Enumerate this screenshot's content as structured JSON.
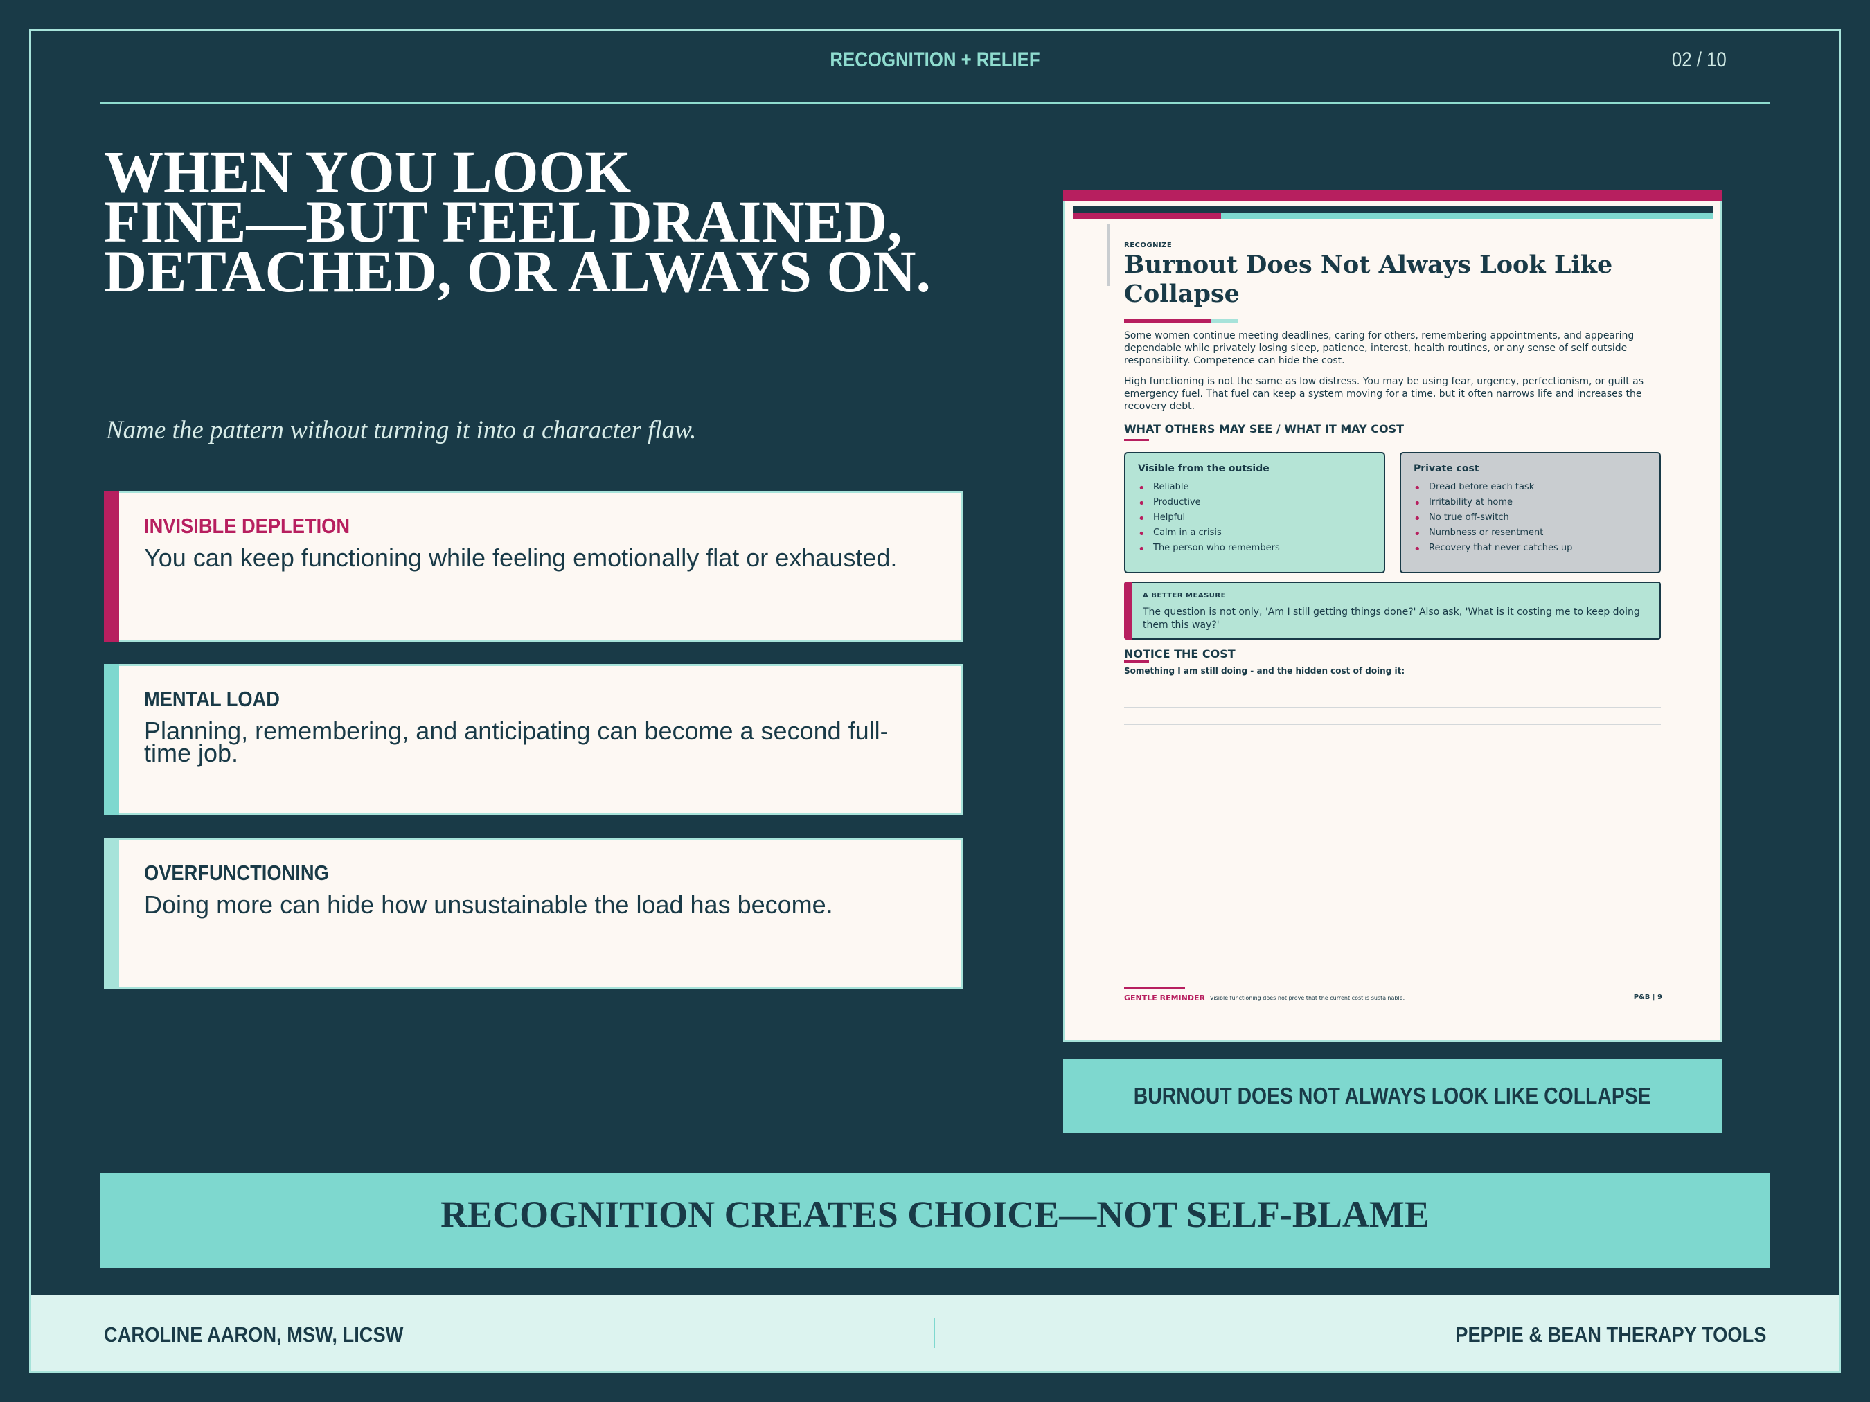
{
  "header": {
    "title": "RECOGNITION + RELIEF",
    "page": "02 / 10"
  },
  "headline": {
    "lines": [
      "WHEN YOU LOOK",
      "FINE—BUT FEEL DRAINED,",
      "DETACHED, OR ALWAYS ON."
    ]
  },
  "subline": "Name the pattern without turning it into a character flaw.",
  "cards": [
    {
      "title": "INVISIBLE DEPLETION",
      "body": "You can keep functioning while feeling emotionally flat or exhausted."
    },
    {
      "title": "MENTAL LOAD",
      "body": "Planning, remembering, and anticipating can become a second full-time job."
    },
    {
      "title": "OVERFUNCTIONING",
      "body": "Doing more can hide how unsustainable the load has become."
    }
  ],
  "document": {
    "kicker": "RECOGNIZE",
    "title": "Burnout Does Not Always Look Like Collapse",
    "p1": "Some women continue meeting deadlines, caring for others, remembering appointments, and appearing dependable while privately losing sleep, patience, interest, health routines, or any sense of self outside responsibility. Competence can hide the cost.",
    "p2": "High functioning is not the same as low distress. You may be using fear, urgency, perfectionism, or guilt as emergency fuel. That fuel can keep a system moving for a time, but it often narrows life and increases the recovery debt.",
    "section": "WHAT OTHERS MAY SEE / WHAT IT MAY COST",
    "visible": {
      "title": "Visible from the outside",
      "items": [
        "Reliable",
        "Productive",
        "Helpful",
        "Calm in a crisis",
        "The person who remembers"
      ]
    },
    "private": {
      "title": "Private cost",
      "items": [
        "Dread before each task",
        "Irritability at home",
        "No true off-switch",
        "Numbness or resentment",
        "Recovery that never catches up"
      ]
    },
    "measure": {
      "title": "A BETTER MEASURE",
      "body": "The question is not only, 'Am I still getting things done?' Also ask, 'What is it costing me to keep doing them this way?'"
    },
    "notice": {
      "title": "NOTICE THE COST",
      "prompt": "Something I am still doing - and the hidden cost of doing it:"
    },
    "footer": {
      "label": "GENTLE REMINDER",
      "note": "Visible functioning does not prove that the current cost is sustainable.",
      "page": "P&B  |  9"
    }
  },
  "caption": "BURNOUT DOES NOT ALWAYS LOOK LIKE COLLAPSE",
  "banner": "RECOGNITION CREATES CHOICE—NOT SELF-BLAME",
  "footer": {
    "left": "CAROLINE AARON, MSW, LICSW",
    "right": "PEPPIE & BEAN THERAPY TOOLS"
  },
  "colors": {
    "background": "#193a47",
    "accent": "#b71f5f",
    "teal": "#7ed8cf",
    "paper": "#fdf8f3"
  }
}
